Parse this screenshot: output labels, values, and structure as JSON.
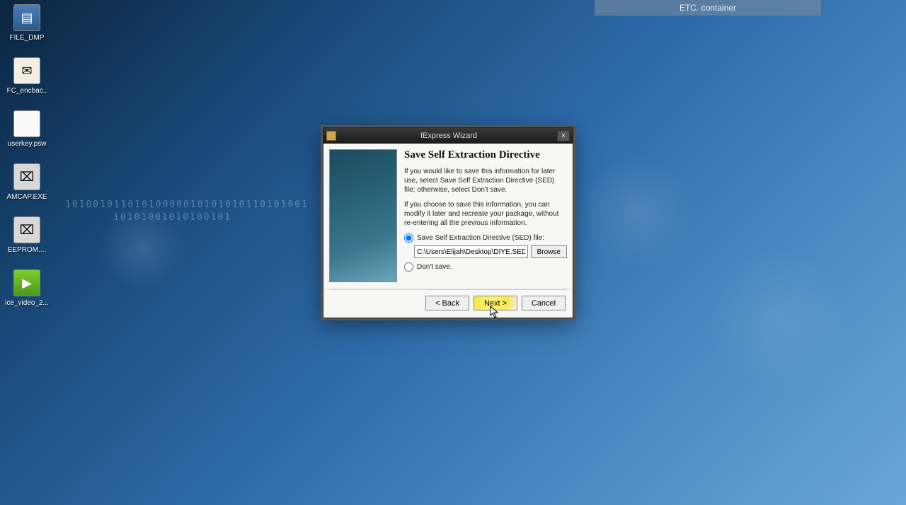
{
  "titlebar": {
    "label": "ETC. container"
  },
  "desktop": {
    "icons": [
      {
        "name": "file-dmp",
        "label": "FILE_DMP",
        "glyph": "▤",
        "cls": "dump"
      },
      {
        "name": "fc-encbac",
        "label": "FC_encbac..",
        "glyph": "✉",
        "cls": "enc"
      },
      {
        "name": "userkey",
        "label": "userkey.psw",
        "glyph": "",
        "cls": "txt"
      },
      {
        "name": "amcap",
        "label": "AMCAP.EXE",
        "glyph": "⌧",
        "cls": "exe"
      },
      {
        "name": "eeprom",
        "label": "EEPROM....",
        "glyph": "⌧",
        "cls": "exe"
      },
      {
        "name": "ice-video",
        "label": "ice_video_2...",
        "glyph": "▶",
        "cls": "play"
      }
    ]
  },
  "wizard": {
    "title": "IExpress Wizard",
    "heading": "Save Self Extraction Directive",
    "para1": "If you would like to save this information for later use, select Save Self Extraction Directive (SED) file; otherwise, select Don't save.",
    "para2": "If you choose to save this information, you can modify it later and recreate your package, without re-entering all the previous information.",
    "option_save": "Save Self Extraction Directive (SED) file:",
    "path_value": "C:\\Users\\Elijah\\Desktop\\DIYE.SED",
    "browse_label": "Browse",
    "option_dont": "Don't save.",
    "buttons": {
      "back": "< Back",
      "next": "Next >",
      "cancel": "Cancel"
    },
    "close_glyph": "×"
  },
  "decor": {
    "binary1": "10100101101010000010101010110101001",
    "binary2": "10101001010100101"
  }
}
